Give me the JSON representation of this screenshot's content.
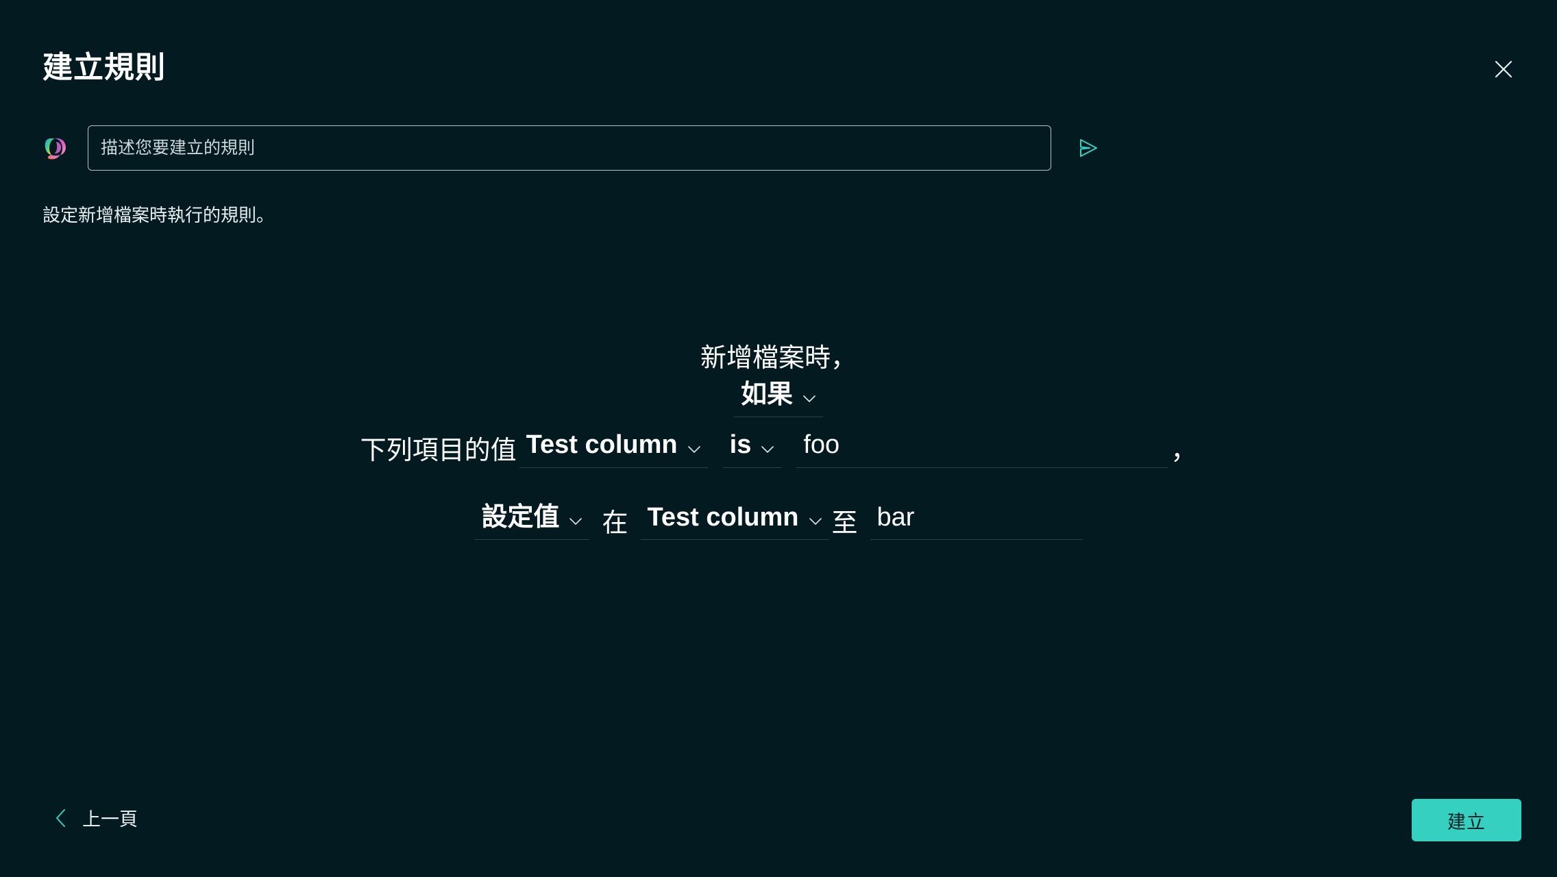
{
  "window": {
    "title": "建立規則",
    "background_color": "#021a20"
  },
  "header": {
    "title": "建立規則",
    "close_icon": "close-icon"
  },
  "prompt": {
    "copilot_icon": "copilot-icon",
    "placeholder": "描述您要建立的規則",
    "value": "",
    "send_icon": "send-icon"
  },
  "description": {
    "text": "設定新增檔案時執行的規則。"
  },
  "rule": {
    "trigger_text": "新增檔案時，",
    "if_dropdown": {
      "label": "如果",
      "chevron_icon": "chevron-down-icon"
    },
    "condition": {
      "prefix_text": "下列項目的值",
      "column_dropdown": {
        "label": "Test column",
        "chevron_icon": "chevron-down-icon"
      },
      "operator_dropdown": {
        "label": "is",
        "chevron_icon": "chevron-down-icon"
      },
      "value_field": {
        "value": "foo",
        "placeholder": ""
      },
      "suffix_text": "，"
    },
    "action": {
      "action_dropdown": {
        "label": "設定值",
        "chevron_icon": "chevron-down-icon"
      },
      "in_text": "在",
      "column_dropdown": {
        "label": "Test column",
        "chevron_icon": "chevron-down-icon"
      },
      "to_text": "至",
      "value_field": {
        "value": "bar",
        "placeholder": ""
      }
    }
  },
  "footer": {
    "back_label": "上一頁",
    "back_icon": "chevron-left-icon",
    "create_label": "建立",
    "accent_color": "#35d0c0"
  }
}
